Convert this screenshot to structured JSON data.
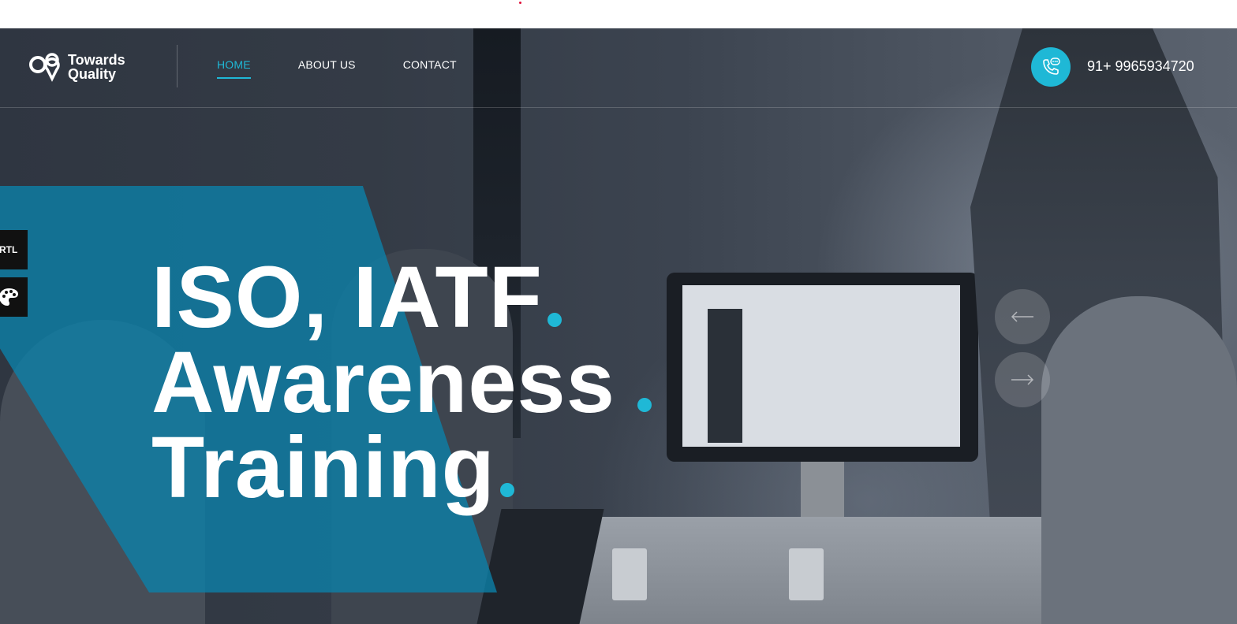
{
  "brand": {
    "line1": "Towards",
    "line2": "Quality"
  },
  "nav": {
    "items": [
      {
        "label": "HOME",
        "active": true
      },
      {
        "label": "ABOUT US",
        "active": false
      },
      {
        "label": "CONTACT",
        "active": false
      }
    ]
  },
  "contact": {
    "phone": "91+ 9965934720",
    "icon": "phone-chat-icon"
  },
  "side_tools": {
    "rtl_label": "RTL",
    "palette_icon": "palette-icon"
  },
  "hero": {
    "lines": [
      "ISO, IATF",
      "Awareness",
      "Training"
    ]
  },
  "slider": {
    "prev_icon": "arrow-left-icon",
    "next_icon": "arrow-right-icon"
  },
  "colors": {
    "accent": "#1fb8d6",
    "band": "#0c82aa",
    "dark": "#111111"
  }
}
